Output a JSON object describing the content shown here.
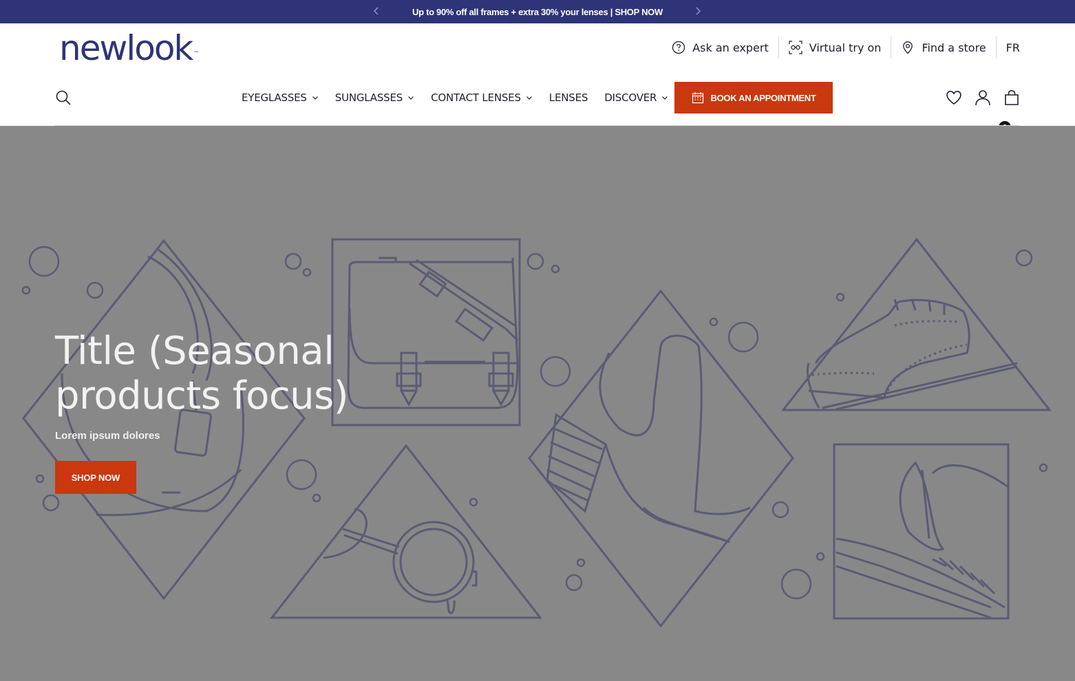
{
  "announcement": {
    "message": "Up to 90% off all frames + extra 30% your lenses | SHOP NOW",
    "prev_icon": "chevron-left-icon",
    "next_icon": "chevron-right-icon"
  },
  "header": {
    "logo_text": "newlook",
    "logo_mark": "™",
    "utility": [
      {
        "label": "Ask an expert",
        "icon": "help-circle-icon"
      },
      {
        "label": "Virtual try on",
        "icon": "virtual-try-on-icon"
      },
      {
        "label": "Find a store",
        "icon": "map-pin-icon"
      },
      {
        "label": "FR"
      }
    ],
    "nav": [
      {
        "label": "EYEGLASSES",
        "has_dropdown": true
      },
      {
        "label": "SUNGLASSES",
        "has_dropdown": true
      },
      {
        "label": "CONTACT LENSES",
        "has_dropdown": true
      },
      {
        "label": "LENSES",
        "has_dropdown": false
      },
      {
        "label": "DISCOVER",
        "has_dropdown": true
      }
    ],
    "book_button": "BOOK AN APPOINTMENT",
    "cart_count": "0"
  },
  "hero": {
    "title": "Title (Seasonal products focus)",
    "subtitle": "Lorem ipsum dolores",
    "cta": "SHOP NOW"
  },
  "colors": {
    "brand_navy": "#2e3477",
    "accent_orange": "#c9380f",
    "hero_background": "#888888",
    "hero_line_art": "#5b5b73"
  }
}
